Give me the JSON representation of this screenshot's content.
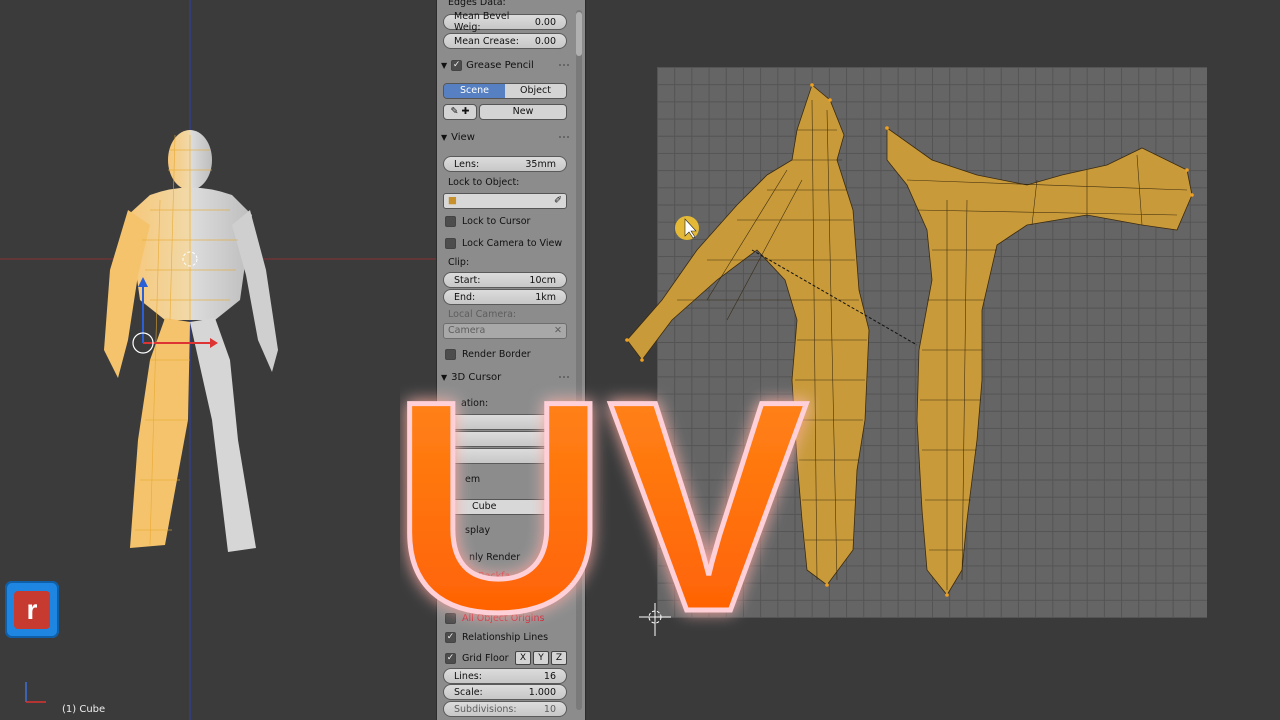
{
  "panel": {
    "edges_data_heading": "Edges Data:",
    "mean_bevel": {
      "label": "Mean Bevel Weig:",
      "value": "0.00"
    },
    "mean_crease": {
      "label": "Mean Crease:",
      "value": "0.00"
    },
    "grease_pencil": {
      "title": "Grease Pencil",
      "checked": true,
      "tabs": [
        "Scene",
        "Object"
      ],
      "active_tab": "Scene",
      "new_label": "New"
    },
    "view": {
      "title": "View",
      "lens": {
        "label": "Lens:",
        "value": "35mm"
      },
      "lock_to_object_label": "Lock to Object:",
      "lock_to_cursor": "Lock to Cursor",
      "lock_camera_to_view": "Lock Camera to View",
      "clip_label": "Clip:",
      "clip_start": {
        "label": "Start:",
        "value": "10cm"
      },
      "clip_end": {
        "label": "End:",
        "value": "1km"
      },
      "local_camera_label": "Local Camera:",
      "camera_field": "Camera",
      "render_border": "Render Border"
    },
    "cursor3d": {
      "title": "3D Cursor",
      "location_label": "ation:"
    },
    "item": {
      "title": "em",
      "name_value": "Cube"
    },
    "display": {
      "title": "splay",
      "only_render": "nly Render",
      "backface": "d Backfa",
      "all_object_origins": "All Object Origins",
      "relationship_lines": "Relationship Lines",
      "grid_floor": "Grid Floor",
      "axes": [
        "X",
        "Y",
        "Z"
      ],
      "lines": {
        "label": "Lines:",
        "value": "16"
      },
      "scale": {
        "label": "Scale:",
        "value": "1.000"
      },
      "subdivisions": {
        "label": "Subdivisions:",
        "value": "10"
      }
    }
  },
  "viewport": {
    "object_label": "(1) Cube"
  },
  "overlay": {
    "title": "UV",
    "logo_letter": "r"
  },
  "colors": {
    "accent": "#5680c2",
    "mesh": "#c79a35",
    "title_orange": "#ff6a00",
    "logo_blue": "#1e86e0"
  }
}
